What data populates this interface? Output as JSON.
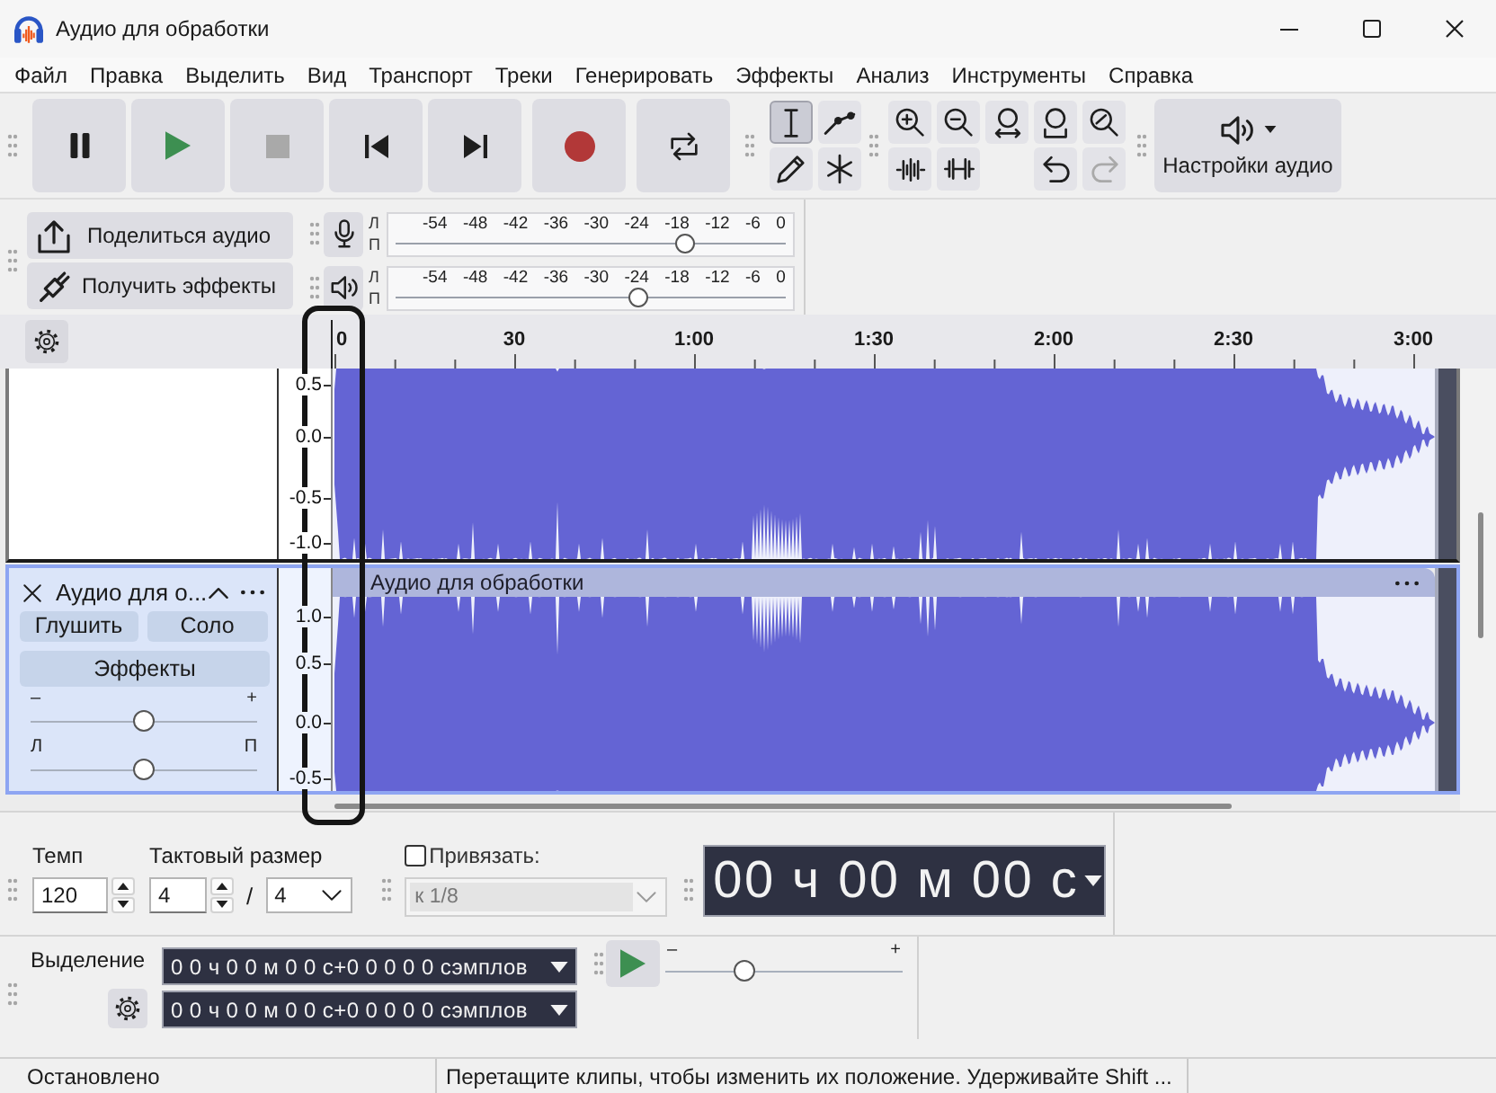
{
  "window": {
    "title": "Аудио для обработки"
  },
  "menu": [
    "Файл",
    "Правка",
    "Выделить",
    "Вид",
    "Транспорт",
    "Треки",
    "Генерировать",
    "Эффекты",
    "Анализ",
    "Инструменты",
    "Справка"
  ],
  "transport": [
    {
      "kind": "pause",
      "disabled": false
    },
    {
      "kind": "play",
      "disabled": false
    },
    {
      "kind": "stop",
      "disabled": true
    },
    {
      "kind": "skip_start",
      "disabled": false
    },
    {
      "kind": "skip_end",
      "disabled": false
    },
    {
      "kind": "record",
      "disabled": false
    },
    {
      "kind": "loop",
      "disabled": false
    }
  ],
  "tools": [
    {
      "kind": "select",
      "selected": true
    },
    {
      "kind": "envelope",
      "selected": false
    },
    {
      "kind": "draw",
      "selected": false
    },
    {
      "kind": "multi",
      "selected": false
    }
  ],
  "zoom_tools": [
    {
      "kind": "zoom_in"
    },
    {
      "kind": "zoom_out"
    },
    {
      "kind": "fit_selection"
    },
    {
      "kind": "fit_project"
    },
    {
      "kind": "zoom_toggle"
    }
  ],
  "edit_tools": [
    {
      "kind": "trim"
    },
    {
      "kind": "silence"
    }
  ],
  "history_tools": [
    {
      "kind": "undo",
      "disabled": false
    },
    {
      "kind": "redo",
      "disabled": true
    }
  ],
  "audio_setup": {
    "label": "Настройки аудио"
  },
  "share_buttons": [
    {
      "kind": "share",
      "label": "Поделиться аудио"
    },
    {
      "kind": "plugin",
      "label": "Получить эффекты"
    }
  ],
  "meters": [
    {
      "kind": "record",
      "channels": [
        "Л",
        "П"
      ],
      "scale": [
        "-54",
        "-48",
        "-42",
        "-36",
        "-30",
        "-24",
        "-18",
        "-12",
        "-6",
        "0"
      ],
      "level": 0.74
    },
    {
      "kind": "playback",
      "channels": [
        "Л",
        "П"
      ],
      "scale": [
        "-54",
        "-48",
        "-42",
        "-36",
        "-30",
        "-24",
        "-18",
        "-12",
        "-6",
        "0"
      ],
      "level": 0.62
    }
  ],
  "timeline": {
    "labels": [
      "0",
      "30",
      "1:00",
      "1:30",
      "2:00",
      "2:30",
      "3:00"
    ]
  },
  "tracks": [
    {
      "selected": false,
      "scale": [
        "0.5",
        "0.0",
        "-0.5",
        "-1.0"
      ]
    },
    {
      "selected": true,
      "name": "Аудио для о...",
      "mute": "Глушить",
      "solo": "Соло",
      "effects": "Эффекты",
      "gain": {
        "minus": "–",
        "plus": "+",
        "level": 0.5
      },
      "pan": {
        "left": "Л",
        "right": "П",
        "level": 0.5
      },
      "scale": [
        "1.0",
        "0.5",
        "0.0",
        "-0.5"
      ],
      "clip": {
        "title": "Аудио для обработки"
      }
    }
  ],
  "tempo": {
    "label": "Темп",
    "value": "120"
  },
  "time_signature": {
    "label": "Тактовый размер",
    "beats": "4",
    "separator": "/",
    "unit": "4"
  },
  "snap": {
    "label": "Привязать:",
    "checked": false,
    "value": "к 1/8"
  },
  "time_display": {
    "value": "00 ч 00 м 00 с"
  },
  "selection": {
    "label": "Выделение",
    "fields": [
      "0 0 ч 0 0 м 0 0 с+0 0 0 0 0 сэмплов",
      "0 0 ч 0 0 м 0 0 с+0 0 0 0 0 сэмплов"
    ]
  },
  "play_at_speed": {
    "minus": "–",
    "plus": "+",
    "level": 0.33
  },
  "status_bar": [
    "Остановлено",
    "Перетащите клипы, чтобы изменить их положение. Удерживайте Shift ..."
  ]
}
